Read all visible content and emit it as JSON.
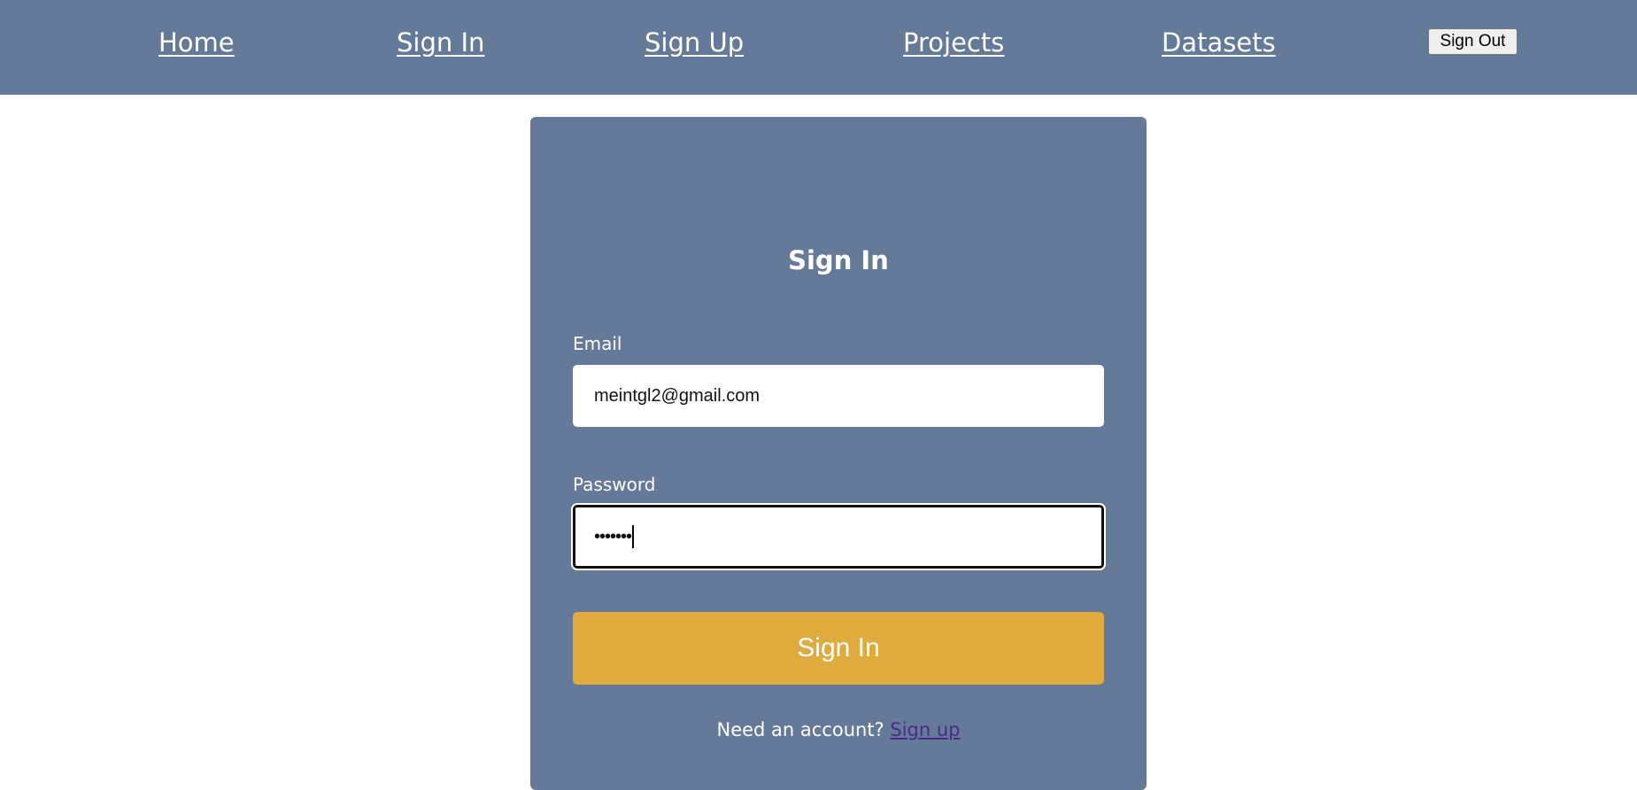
{
  "nav": {
    "home": "Home",
    "sign_in": "Sign In",
    "sign_up": "Sign Up",
    "projects": "Projects",
    "datasets": "Datasets",
    "sign_out": "Sign Out"
  },
  "form": {
    "title": "Sign In",
    "email_label": "Email",
    "email_value": "meintgl2@gmail.com",
    "password_label": "Password",
    "password_masked": "•••••••",
    "submit_label": "Sign In",
    "footer_text": "Need an account?",
    "footer_link": "Sign up"
  },
  "colors": {
    "nav_bg": "#647a98",
    "card_bg": "#647a98",
    "button_bg": "#dfaa3e",
    "link": "#4b2a8a"
  }
}
